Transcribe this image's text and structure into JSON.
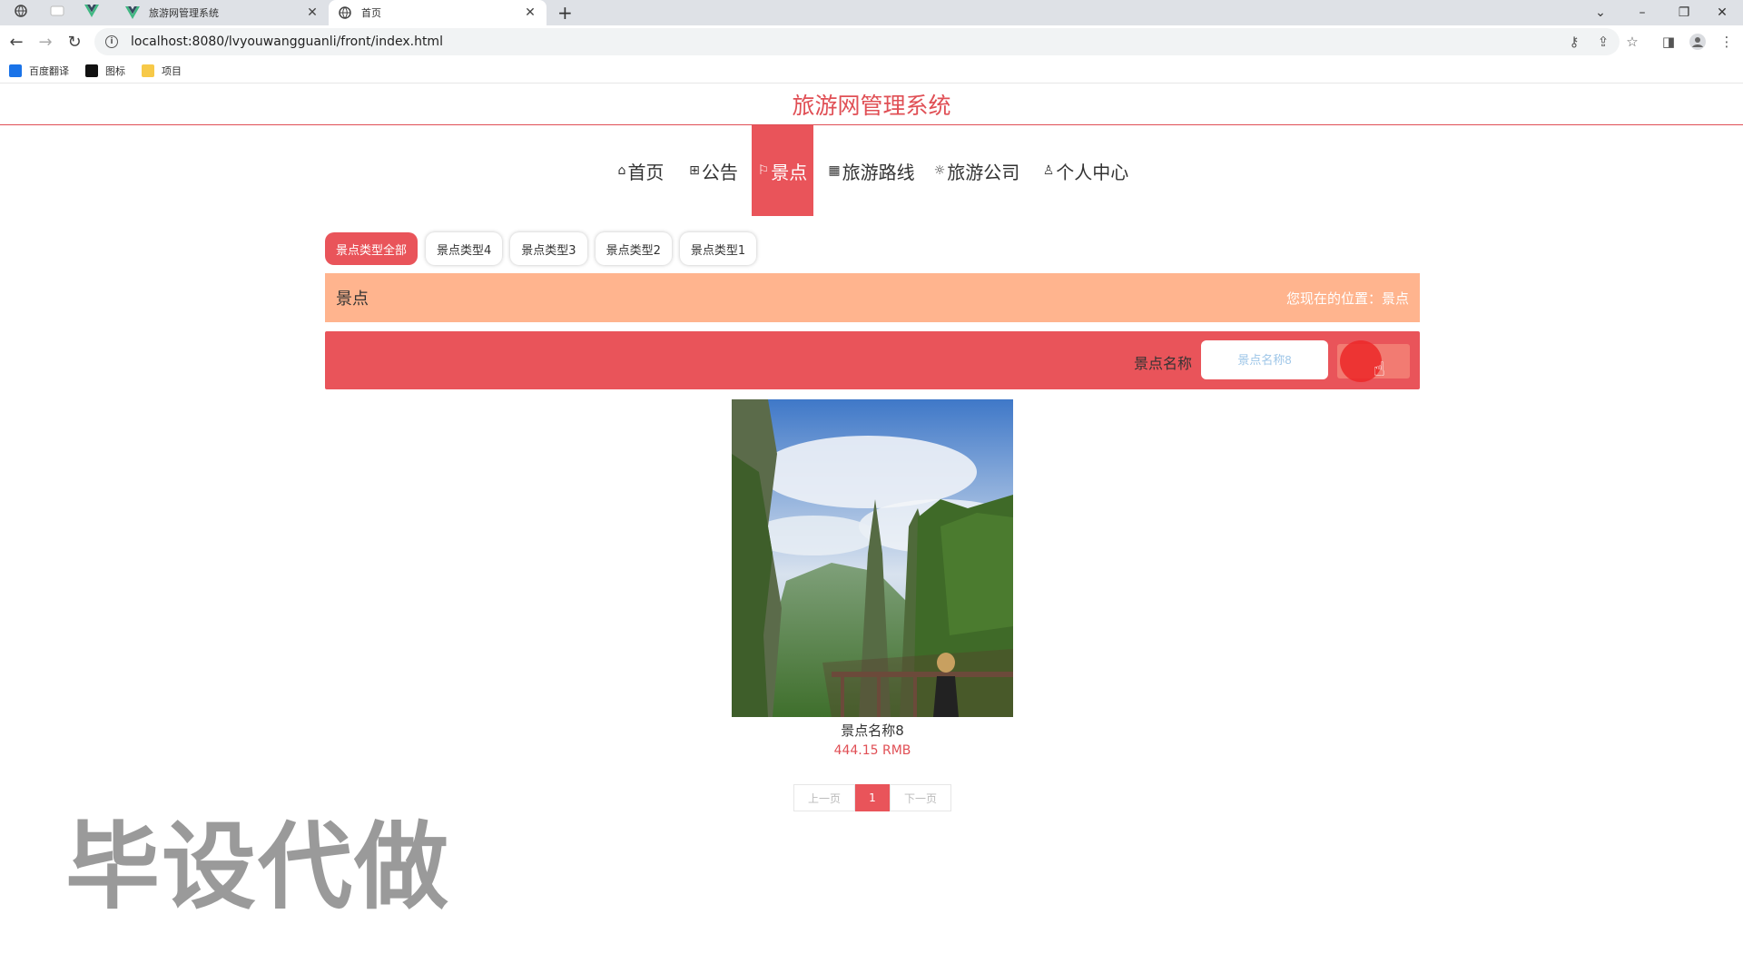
{
  "browser": {
    "tabs": [
      {
        "title": "旅游网管理系统",
        "active": false
      },
      {
        "title": "首页",
        "active": true
      }
    ],
    "url": "localhost:8080/lvyouwangguanli/front/index.html",
    "bookmarks": [
      {
        "label": "百度翻译",
        "icon": "translate-icon",
        "color": "#1a73e8"
      },
      {
        "label": "图标",
        "icon": "image-icon",
        "color": "#111111"
      },
      {
        "label": "项目",
        "icon": "folder-icon",
        "color": "#f7c948"
      }
    ]
  },
  "site": {
    "title": "旅游网管理系统",
    "accent": "#e9545a"
  },
  "nav": [
    {
      "label": "首页",
      "icon": "home-icon",
      "glyph": "⌂",
      "active": false
    },
    {
      "label": "公告",
      "icon": "notice-icon",
      "glyph": "⊞",
      "active": false
    },
    {
      "label": "景点",
      "icon": "flag-icon",
      "glyph": "⚐",
      "active": true
    },
    {
      "label": "旅游路线",
      "icon": "route-icon",
      "glyph": "▦",
      "active": false
    },
    {
      "label": "旅游公司",
      "icon": "gear-icon",
      "glyph": "☼",
      "active": false
    },
    {
      "label": "个人中心",
      "icon": "user-icon",
      "glyph": "♙",
      "active": false
    }
  ],
  "categories": [
    {
      "label": "景点类型全部",
      "active": true
    },
    {
      "label": "景点类型4",
      "active": false
    },
    {
      "label": "景点类型3",
      "active": false
    },
    {
      "label": "景点类型2",
      "active": false
    },
    {
      "label": "景点类型1",
      "active": false
    }
  ],
  "breadcrumb": {
    "title": "景点",
    "location": "您现在的位置：景点"
  },
  "search": {
    "label": "景点名称",
    "placeholder": "景点名称8",
    "button": ""
  },
  "items": [
    {
      "name": "景点名称8",
      "price": "444.15 RMB"
    }
  ],
  "pager": {
    "prev": "上一页",
    "current": "1",
    "next": "下一页"
  },
  "watermark": "毕设代做"
}
